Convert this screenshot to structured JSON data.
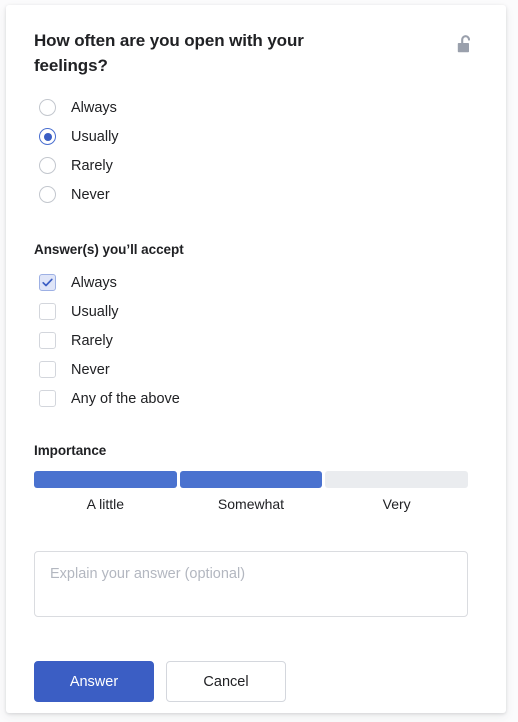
{
  "card": {
    "question": {
      "title": "How often are you open with your feelings?",
      "lock_icon": "unlocked-padlock-icon"
    },
    "radio_group": {
      "name": "frequency",
      "selected": "Usually",
      "options": [
        {
          "label": "Always",
          "selected": false
        },
        {
          "label": "Usually",
          "selected": true
        },
        {
          "label": "Rarely",
          "selected": false
        },
        {
          "label": "Never",
          "selected": false
        }
      ]
    },
    "accept_section": {
      "label": "Answer(s) you’ll accept",
      "options": [
        {
          "label": "Always",
          "checked": true
        },
        {
          "label": "Usually",
          "checked": false
        },
        {
          "label": "Rarely",
          "checked": false
        },
        {
          "label": "Never",
          "checked": false
        },
        {
          "label": "Any of the above",
          "checked": false
        }
      ]
    },
    "importance": {
      "label": "Importance",
      "levels": [
        {
          "label": "A little",
          "filled": true
        },
        {
          "label": "Somewhat",
          "filled": true
        },
        {
          "label": "Very",
          "filled": false
        }
      ],
      "selected_level": "Somewhat",
      "filled_count": 2,
      "total_levels": 3
    },
    "explain": {
      "value": "",
      "placeholder": "Explain your answer (optional)"
    },
    "actions": {
      "submit_label": "Answer",
      "cancel_label": "Cancel"
    }
  },
  "colors": {
    "accent_blue": "#3b5ec4",
    "segment_filled": "#4a72cf",
    "segment_empty": "#eaecef",
    "checkbox_checked_fill": "#dfe5f8",
    "text_primary": "#202124",
    "placeholder": "#b3b7c0",
    "lock_gray": "#9aa0ac",
    "card_background": "#ffffff",
    "page_background": "#fbfbfc"
  }
}
